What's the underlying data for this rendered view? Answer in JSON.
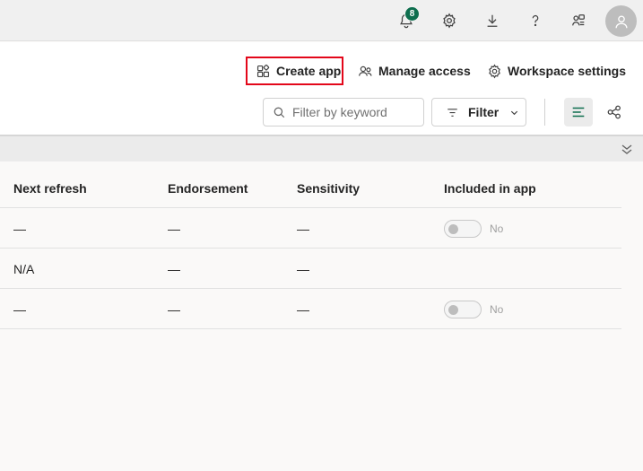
{
  "topbar": {
    "notification_count": "8",
    "icons": [
      "bell-icon",
      "gear-icon",
      "download-icon",
      "help-icon",
      "share-icon",
      "avatar-icon"
    ]
  },
  "actions": {
    "create_app": "Create app",
    "manage_access": "Manage access",
    "workspace_settings": "Workspace settings"
  },
  "toolbar": {
    "search_placeholder": "Filter by keyword",
    "filter_label": "Filter"
  },
  "table": {
    "columns": [
      "Next refresh",
      "Endorsement",
      "Sensitivity",
      "Included in app"
    ],
    "rows": [
      {
        "next_refresh": "—",
        "endorsement": "—",
        "sensitivity": "—",
        "included_label": "No",
        "has_toggle": true
      },
      {
        "next_refresh": "N/A",
        "endorsement": "—",
        "sensitivity": "—",
        "included_label": "",
        "has_toggle": false
      },
      {
        "next_refresh": "—",
        "endorsement": "—",
        "sensitivity": "—",
        "included_label": "No",
        "has_toggle": true
      }
    ]
  },
  "colors": {
    "accent": "#0e6e4e",
    "highlight_border": "#e3071a"
  }
}
